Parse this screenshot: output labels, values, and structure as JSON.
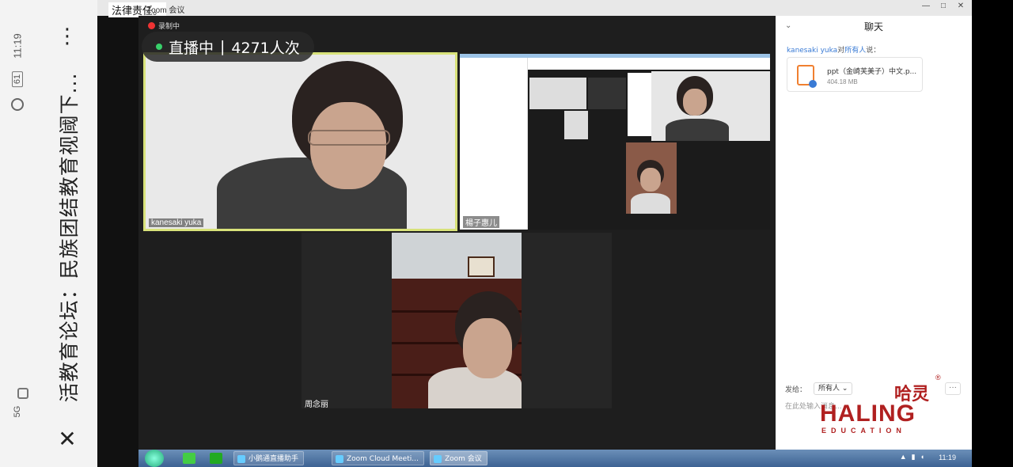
{
  "phone": {
    "title": "活教育论坛：民族团结教育视阈下...",
    "time": "11:19",
    "battery": "61",
    "signal": "5G"
  },
  "screen": {
    "top_left_text": "法律责任。",
    "zoom_window_title": "Zoom 会议"
  },
  "meeting": {
    "recording_label": "录制中",
    "live_label": "直播中",
    "live_count": "4271人次",
    "participants": {
      "main": "kanesaki yuka",
      "share_name": "楊子惠儿",
      "bottom": "周念丽"
    }
  },
  "chat": {
    "header": "聊天",
    "sender": "kanesaki yuka",
    "to_word": "对",
    "recipient": "所有人",
    "said": "说：",
    "file_name": "ppt（金崎芙美子）中文.p...",
    "file_size": "404.18 MB",
    "send_to_label": "发给：",
    "send_to_value": "所有人",
    "input_placeholder": "在此处输入消息...",
    "more": "···"
  },
  "watermark": {
    "cn": "哈灵",
    "reg": "®",
    "en": "HALING",
    "edu": "EDUCATION"
  },
  "taskbar": {
    "items": [
      "小鹅通直播助手",
      "Zoom Cloud Meeti...",
      "Zoom 会议"
    ],
    "time": "11:19"
  }
}
